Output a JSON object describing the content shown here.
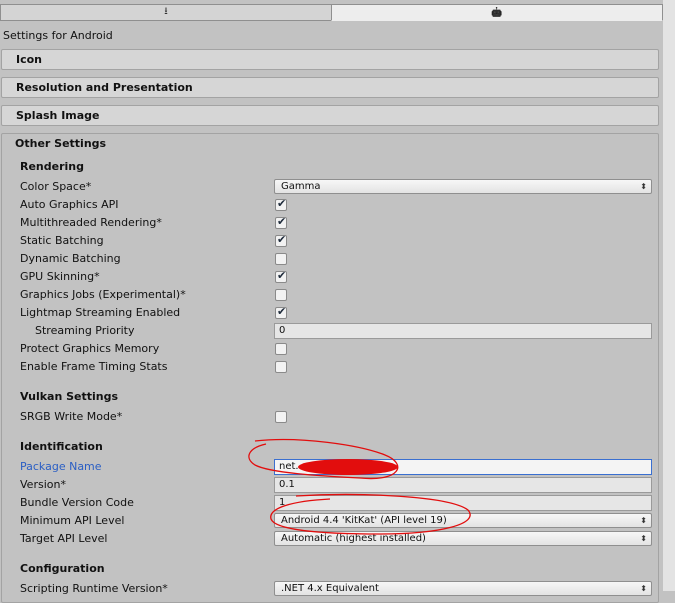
{
  "platform_tabs": {
    "left_icon": "download-icon",
    "right_icon": "android-icon",
    "right_glyph": "🤖",
    "left_glyph": "⭳"
  },
  "title": "Settings for Android",
  "foldouts": {
    "icon": "Icon",
    "resolution": "Resolution and Presentation",
    "splash": "Splash Image",
    "other": "Other Settings"
  },
  "rendering": {
    "header": "Rendering",
    "color_space_label": "Color Space*",
    "color_space_value": "Gamma",
    "auto_graphics_api": {
      "label": "Auto Graphics API",
      "checked": true
    },
    "multithreaded": {
      "label": "Multithreaded Rendering*",
      "checked": true
    },
    "static_batching": {
      "label": "Static Batching",
      "checked": true
    },
    "dynamic_batching": {
      "label": "Dynamic Batching",
      "checked": false
    },
    "gpu_skinning": {
      "label": "GPU Skinning*",
      "checked": true
    },
    "graphics_jobs": {
      "label": "Graphics Jobs (Experimental)*",
      "checked": false
    },
    "lightmap_streaming": {
      "label": "Lightmap Streaming Enabled",
      "checked": true
    },
    "streaming_priority_label": "Streaming Priority",
    "streaming_priority_value": "0",
    "protect_graphics_memory": {
      "label": "Protect Graphics Memory",
      "checked": false
    },
    "frame_timing": {
      "label": "Enable Frame Timing Stats",
      "checked": false
    }
  },
  "vulkan": {
    "header": "Vulkan Settings",
    "srgb": {
      "label": "SRGB Write Mode*",
      "checked": false
    }
  },
  "identification": {
    "header": "Identification",
    "package_name_label": "Package Name",
    "package_name_value": "net.",
    "version_label": "Version*",
    "version_value": "0.1",
    "bundle_label": "Bundle Version Code",
    "bundle_value": "1",
    "min_api_label": "Minimum API Level",
    "min_api_value": "Android 4.4 'KitKat' (API level 19)",
    "target_api_label": "Target API Level",
    "target_api_value": "Automatic (highest installed)"
  },
  "configuration": {
    "header": "Configuration",
    "scripting_runtime_label": "Scripting Runtime Version*",
    "scripting_runtime_value": ".NET 4.x Equivalent"
  },
  "colors": {
    "link": "#2a5ec4",
    "annotation": "#e20d0d",
    "focus": "#3a6fd0"
  }
}
